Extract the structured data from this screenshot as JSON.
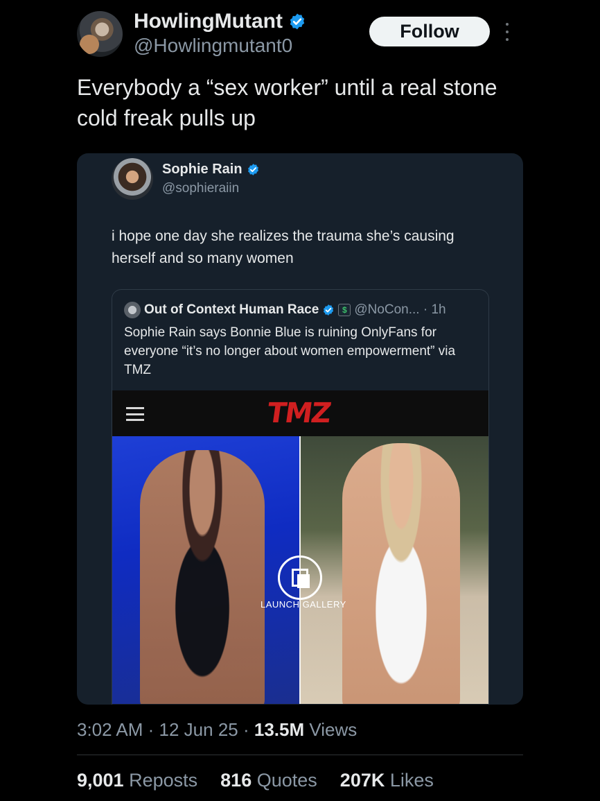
{
  "author": {
    "display_name": "HowlingMutant",
    "handle": "@Howlingmutant0",
    "follow_label": "Follow"
  },
  "tweet": {
    "text": "Everybody a “sex worker” until a real stone cold freak pulls up"
  },
  "quoted": {
    "display_name": "Sophie Rain",
    "handle": "@sophieraiin",
    "text": "i hope one day she realizes the trauma she’s causing herself and so many women",
    "inner": {
      "display_name": "Out of Context Human Race",
      "money_icon": "$",
      "meta": "@NoCon... · 1h",
      "text": "Sophie Rain says Bonnie Blue is ruining OnlyFans for everyone “it’s no longer about women empowerment” via TMZ",
      "media": {
        "brand": "TMZ",
        "gallery_label": "LAUNCH GALLERY"
      }
    }
  },
  "meta": {
    "time": "3:02 AM",
    "date": "12 Jun 25",
    "views_count": "13.5M",
    "views_label": "Views"
  },
  "stats": {
    "reposts_count": "9,001",
    "reposts_label": "Reposts",
    "quotes_count": "816",
    "quotes_label": "Quotes",
    "likes_count": "207K",
    "likes_label": "Likes"
  },
  "colors": {
    "background": "#000000",
    "card": "#16202b",
    "verified": "#1d9bf0",
    "muted_text": "#8b98a5",
    "tmz_red": "#d01f20"
  },
  "icons": [
    "more-options-icon",
    "verified-badge-icon",
    "menu-icon",
    "gallery-icon",
    "money-badge-icon"
  ]
}
